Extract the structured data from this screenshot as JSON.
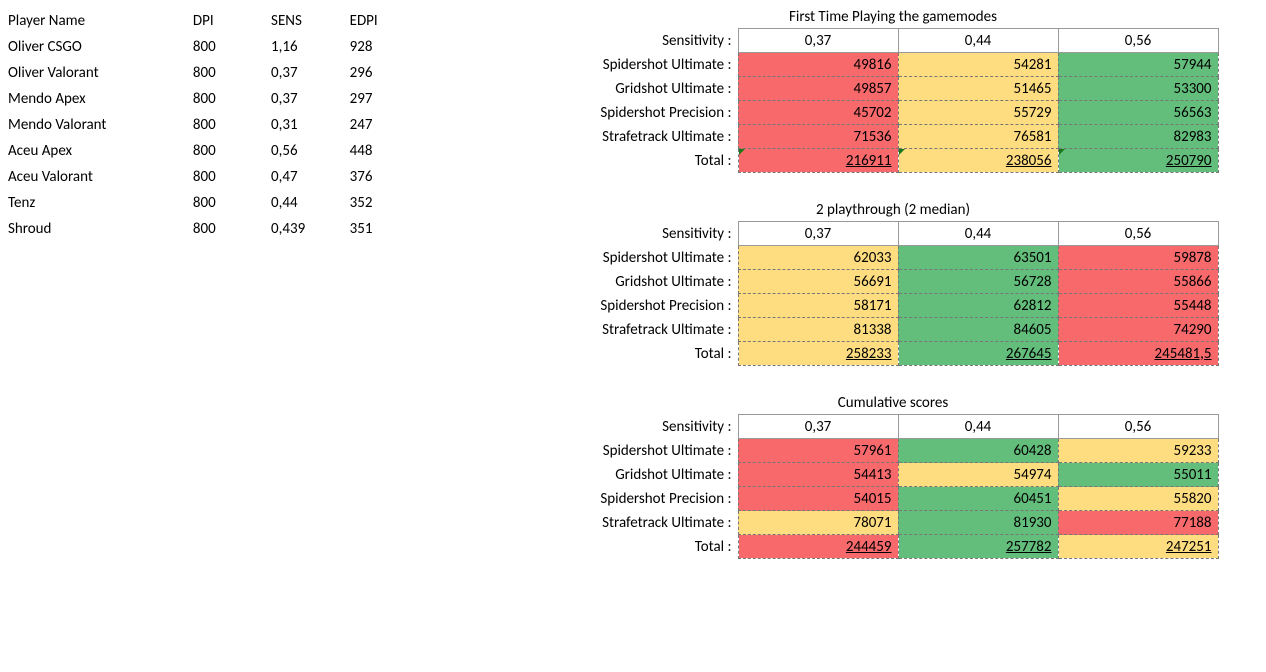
{
  "players": {
    "headers": {
      "name": "Player Name",
      "dpi": "DPI",
      "sens": "SENS",
      "edpi": "EDPI"
    },
    "rows": [
      {
        "name": "Oliver CSGO",
        "dpi": "800",
        "sens": "1,16",
        "edpi": "928"
      },
      {
        "name": "Oliver Valorant",
        "dpi": "800",
        "sens": "0,37",
        "edpi": "296"
      },
      {
        "name": "Mendo Apex",
        "dpi": "800",
        "sens": "0,37",
        "edpi": "297"
      },
      {
        "name": "Mendo Valorant",
        "dpi": "800",
        "sens": "0,31",
        "edpi": "247"
      },
      {
        "name": "Aceu Apex",
        "dpi": "800",
        "sens": "0,56",
        "edpi": "448"
      },
      {
        "name": "Aceu Valorant",
        "dpi": "800",
        "sens": "0,47",
        "edpi": "376"
      },
      {
        "name": "Tenz",
        "dpi": "800",
        "sens": "0,44",
        "edpi": "352"
      },
      {
        "name": "Shroud",
        "dpi": "800",
        "sens": "0,439",
        "edpi": "351"
      }
    ]
  },
  "labels": {
    "sensitivity": "Sensitivity :",
    "spidershot_ultimate": "Spidershot Ultimate :",
    "gridshot_ultimate": "Gridshot Ultimate :",
    "spidershot_precision": "Spidershot Precision :",
    "strafetrack_ultimate": "Strafetrack Ultimate :",
    "total": "Total :"
  },
  "blocks": [
    {
      "title": "First Time Playing the gamemodes",
      "sens": [
        "0,37",
        "0,44",
        "0,56"
      ],
      "rows": [
        {
          "label_key": "spidershot_ultimate",
          "v": [
            "49816",
            "54281",
            "57944"
          ],
          "c": [
            "red",
            "yellow",
            "green"
          ]
        },
        {
          "label_key": "gridshot_ultimate",
          "v": [
            "49857",
            "51465",
            "53300"
          ],
          "c": [
            "red",
            "yellow",
            "green"
          ]
        },
        {
          "label_key": "spidershot_precision",
          "v": [
            "45702",
            "55729",
            "56563"
          ],
          "c": [
            "red",
            "yellow",
            "green"
          ]
        },
        {
          "label_key": "strafetrack_ultimate",
          "v": [
            "71536",
            "76581",
            "82983"
          ],
          "c": [
            "red",
            "yellow",
            "green"
          ]
        }
      ],
      "total": {
        "v": [
          "216911",
          "238056",
          "250790"
        ],
        "c": [
          "red",
          "yellow",
          "green"
        ],
        "tri": [
          true,
          true,
          true
        ]
      }
    },
    {
      "title": "2 playthrough (2 median)",
      "sens": [
        "0,37",
        "0,44",
        "0,56"
      ],
      "rows": [
        {
          "label_key": "spidershot_ultimate",
          "v": [
            "62033",
            "63501",
            "59878"
          ],
          "c": [
            "yellow",
            "green",
            "red"
          ]
        },
        {
          "label_key": "gridshot_ultimate",
          "v": [
            "56691",
            "56728",
            "55866"
          ],
          "c": [
            "yellow",
            "green",
            "red"
          ]
        },
        {
          "label_key": "spidershot_precision",
          "v": [
            "58171",
            "62812",
            "55448"
          ],
          "c": [
            "yellow",
            "green",
            "red"
          ]
        },
        {
          "label_key": "strafetrack_ultimate",
          "v": [
            "81338",
            "84605",
            "74290"
          ],
          "c": [
            "yellow",
            "green",
            "red"
          ]
        }
      ],
      "total": {
        "v": [
          "258233",
          "267645",
          "245481,5"
        ],
        "c": [
          "yellow",
          "green",
          "red"
        ],
        "tri": [
          false,
          false,
          false
        ]
      }
    },
    {
      "title": "Cumulative scores",
      "sens": [
        "0,37",
        "0,44",
        "0,56"
      ],
      "rows": [
        {
          "label_key": "spidershot_ultimate",
          "v": [
            "57961",
            "60428",
            "59233"
          ],
          "c": [
            "red",
            "green",
            "yellow"
          ]
        },
        {
          "label_key": "gridshot_ultimate",
          "v": [
            "54413",
            "54974",
            "55011"
          ],
          "c": [
            "red",
            "yellow",
            "green"
          ]
        },
        {
          "label_key": "spidershot_precision",
          "v": [
            "54015",
            "60451",
            "55820"
          ],
          "c": [
            "red",
            "green",
            "yellow"
          ]
        },
        {
          "label_key": "strafetrack_ultimate",
          "v": [
            "78071",
            "81930",
            "77188"
          ],
          "c": [
            "yellow",
            "green",
            "red"
          ]
        }
      ],
      "total": {
        "v": [
          "244459",
          "257782",
          "247251"
        ],
        "c": [
          "red",
          "green",
          "yellow"
        ],
        "tri": [
          false,
          false,
          false
        ]
      }
    }
  ]
}
